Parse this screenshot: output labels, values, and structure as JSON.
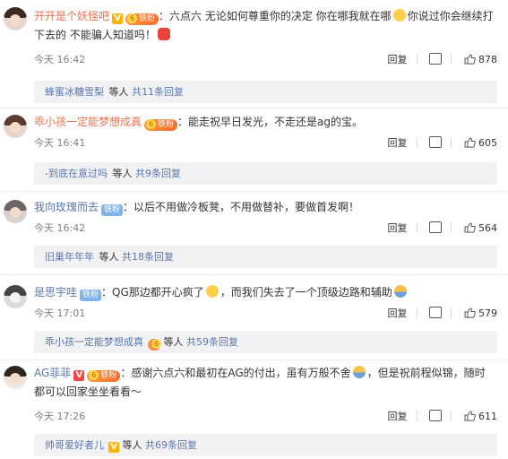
{
  "comments": [
    {
      "username": "开开是个妖怪吧",
      "fan_badge": "铁粉",
      "text_a": "：六点六 无论如何尊重你的决定 你在哪我就在哪",
      "text_b": "你说过你会继续打",
      "text_c": "下去的 不能骗人知道吗！",
      "time": "今天 16:42",
      "reply_label": "回复",
      "likes": "878",
      "sub": {
        "username": "蜂蜜冰糖雪梨",
        "waiting": "等人",
        "count": "共11条回复"
      }
    },
    {
      "username": "乖小孩一定能梦想成真",
      "fan_badge": "铁粉",
      "text_a": "：能走祝早日发光，不走还是ag的宝。",
      "time": "今天 16:41",
      "reply_label": "回复",
      "likes": "605",
      "sub": {
        "username": "-到底在意过吗",
        "waiting": "等人",
        "count": "共9条回复"
      }
    },
    {
      "username": "我向玫瑰而去",
      "fan_badge": "铁粉",
      "text_a": "：以后不用做冷板凳，不用做替补，要做首发啊！",
      "time": "今天 16:42",
      "reply_label": "回复",
      "likes": "564",
      "sub": {
        "username": "旧巢年年年",
        "waiting": "等人",
        "count": "共18条回复"
      }
    },
    {
      "username": "是思宇哇",
      "fan_badge": "铁粉",
      "text_a": "：QG那边都开心疯了",
      "text_b": "，而我们失去了一个顶级边路和辅助",
      "time": "今天 17:01",
      "reply_label": "回复",
      "likes": "579",
      "sub": {
        "username": "乖小孩一定能梦想成真",
        "waiting": "等人",
        "count": "共59条回复"
      }
    },
    {
      "username": "AG菲菲",
      "fan_badge": "铁粉",
      "text_a": "：感谢六点六和最初在AG的付出，虽有万般不舍",
      "text_b": "，但是祝前程似锦，随时",
      "text_c": "都可以回家坐坐看看～",
      "time": "今天 17:26",
      "reply_label": "回复",
      "likes": "611",
      "sub": {
        "username": "帅哥爱好者儿",
        "waiting": "等人",
        "count": "共69条回复"
      }
    }
  ],
  "badges": {
    "v": "V",
    "level": "6"
  },
  "colors": {
    "username": "#eb7350",
    "link": "#5978ab",
    "reply_bg": "#f2f2f5"
  },
  "icons": {
    "share": "share-icon",
    "like": "thumbs-up-icon"
  }
}
